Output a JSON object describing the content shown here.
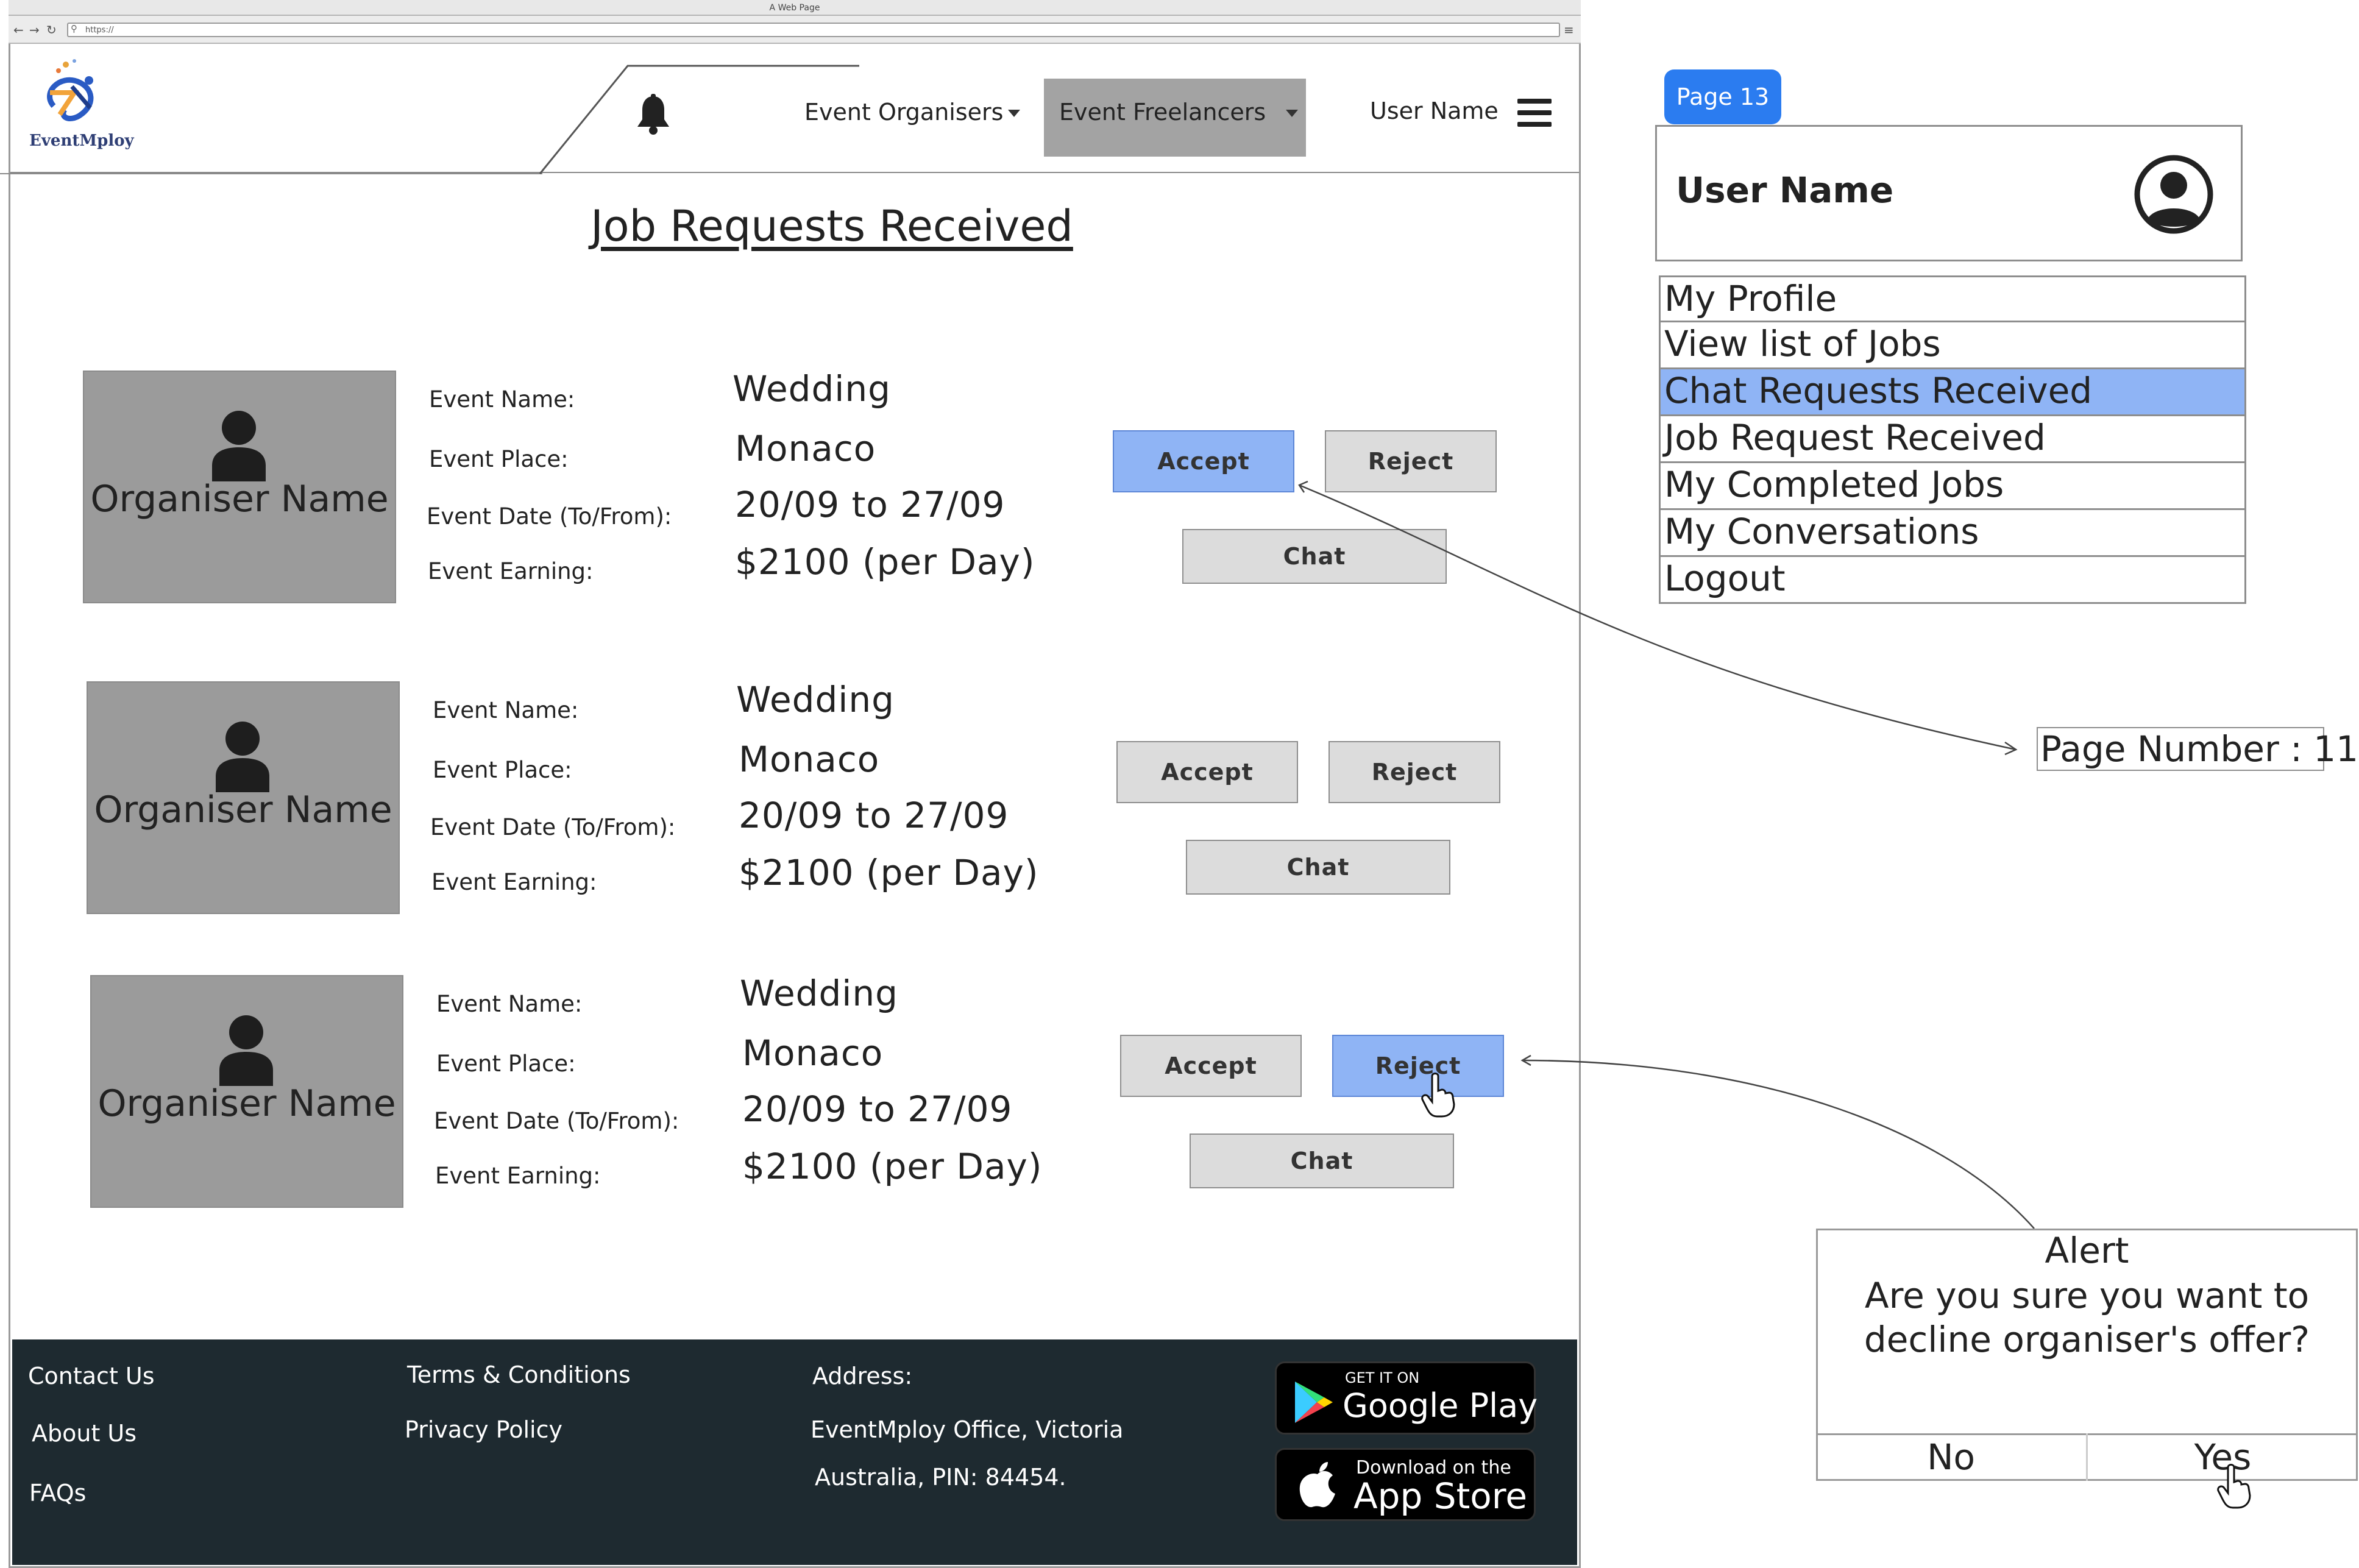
{
  "browser": {
    "title": "A Web Page",
    "url": "https://"
  },
  "header": {
    "logo_text": "EventMploy",
    "nav": {
      "organisers": "Event Organisers",
      "freelancers": "Event Freelancers",
      "user": "User Name"
    }
  },
  "main": {
    "title": "Job Requests Received",
    "labels": {
      "name": "Event Name:",
      "place": "Event Place:",
      "date": "Event Date (To/From):",
      "earning": "Event Earning:"
    },
    "buttons": {
      "accept": "Accept",
      "reject": "Reject",
      "chat": "Chat"
    },
    "requests": [
      {
        "organiser": "Organiser Name",
        "event_name": "Wedding",
        "place": "Monaco",
        "dates": "20/09 to 27/09",
        "earning": "$2100 (per Day)",
        "highlighted": "accept"
      },
      {
        "organiser": "Organiser Name",
        "event_name": "Wedding",
        "place": "Monaco",
        "dates": "20/09 to 27/09",
        "earning": "$2100 (per Day)",
        "highlighted": "none"
      },
      {
        "organiser": "Organiser Name",
        "event_name": "Wedding",
        "place": "Monaco",
        "dates": "20/09 to 27/09",
        "earning": "$2100 (per Day)",
        "highlighted": "reject"
      }
    ]
  },
  "footer": {
    "contact": "Contact Us",
    "about": "About Us",
    "faqs": "FAQs",
    "terms": "Terms & Conditions",
    "privacy": "Privacy Policy",
    "address_label": "Address:",
    "address_line1": "EventMploy Office, Victoria",
    "address_line2": "Australia, PIN: 84454.",
    "google_small": "GET IT ON",
    "google_big": "Google Play",
    "apple_small": "Download on the",
    "apple_big": "App Store"
  },
  "side_panel": {
    "page_label": "Page 13",
    "user_name": "User Name",
    "menu": [
      {
        "label": "My Profile",
        "selected": false
      },
      {
        "label": "View list of Jobs",
        "selected": false
      },
      {
        "label": "Chat Requests Received",
        "selected": true
      },
      {
        "label": "Job Request Received",
        "selected": false
      },
      {
        "label": "My Completed Jobs",
        "selected": false
      },
      {
        "label": "My Conversations",
        "selected": false
      },
      {
        "label": "Logout",
        "selected": false
      }
    ]
  },
  "annotation": {
    "page_number": "Page Number : 11"
  },
  "alert": {
    "title": "Alert",
    "message_line1": "Are you sure you want to",
    "message_line2": "decline organiser's offer?",
    "no": "No",
    "yes": "Yes"
  },
  "colors": {
    "accent_blue": "#8fb4f5",
    "page_pill": "#2b7cf0",
    "footer_bg": "#1e2a30",
    "avatar_gray": "#9b9b9b",
    "nav_active_bg": "#a3a3a3"
  }
}
